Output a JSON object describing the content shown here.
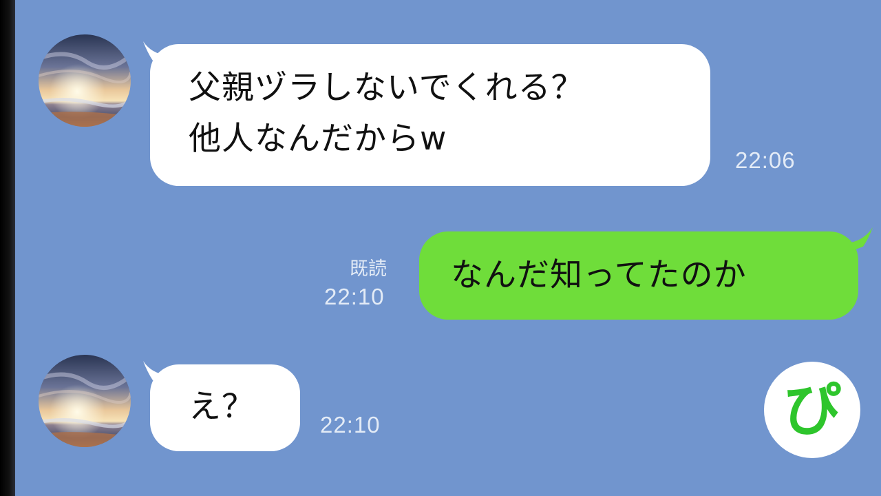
{
  "colors": {
    "background": "#7195ce",
    "incoming_bubble": "#ffffff",
    "outgoing_bubble": "#6fdd3a",
    "timestamp_text": "#e3ebf6",
    "logo_green": "#2ec52c"
  },
  "messages": [
    {
      "direction": "incoming",
      "lines": [
        "父親ヅラしないでくれる？",
        "他人なんだからw"
      ],
      "time": "22:06",
      "avatar": "sunset-beach-avatar"
    },
    {
      "direction": "outgoing",
      "lines": [
        "なんだ知ってたのか"
      ],
      "read_label": "既読",
      "time": "22:10"
    },
    {
      "direction": "incoming",
      "lines": [
        "え？"
      ],
      "time": "22:10",
      "avatar": "sunset-beach-avatar"
    }
  ],
  "logo": {
    "char": "ぴ",
    "icon": "pi-logo-icon"
  }
}
